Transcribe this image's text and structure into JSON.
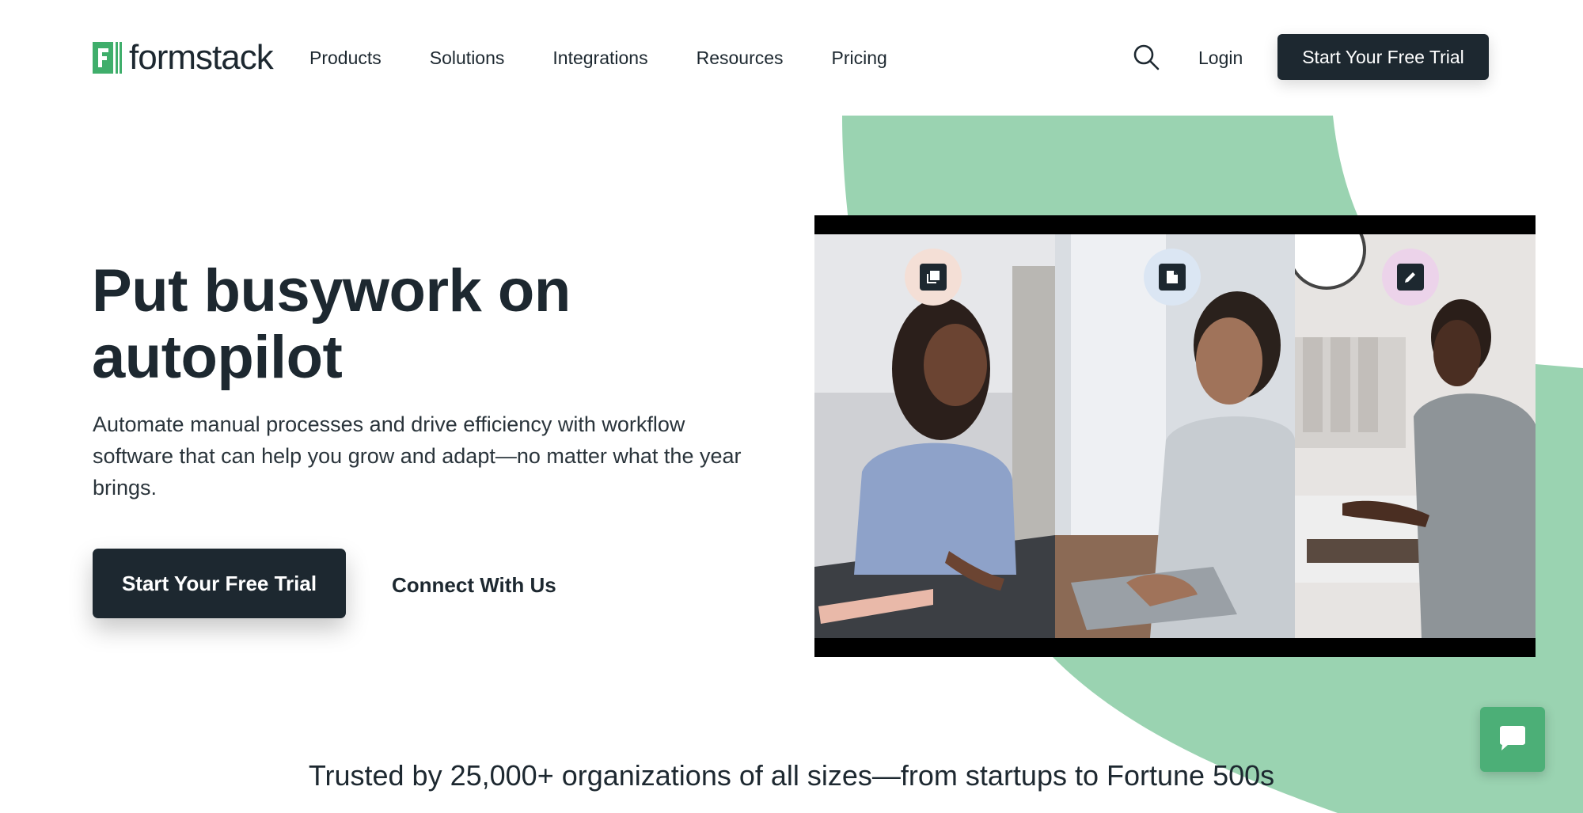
{
  "brand": {
    "name": "formstack",
    "accent": "#9ad3b1",
    "dark": "#1d2830",
    "logo_green": "#3fae6b"
  },
  "nav": {
    "items": [
      {
        "label": "Products"
      },
      {
        "label": "Solutions"
      },
      {
        "label": "Integrations"
      },
      {
        "label": "Resources"
      },
      {
        "label": "Pricing"
      }
    ],
    "search_icon": "search-icon",
    "login_label": "Login",
    "cta_label": "Start Your Free Trial"
  },
  "hero": {
    "title": "Put busywork on autopilot",
    "subtitle": "Automate manual processes and drive efficiency with workflow software that can help you grow and adapt—no matter what the year brings.",
    "primary_cta": "Start Your Free Trial",
    "secondary_cta": "Connect With Us"
  },
  "video": {
    "panels": [
      {
        "icon": "copy-forms-icon",
        "icon_bg": "#f4dfd6"
      },
      {
        "icon": "document-icon",
        "icon_bg": "#dbe6f3"
      },
      {
        "icon": "pen-sign-icon",
        "icon_bg": "#ecd3ea"
      }
    ]
  },
  "trusted_text": "Trusted by 25,000+ organizations of all sizes—from startups to Fortune 500s",
  "chat": {
    "icon": "chat-bubble-icon"
  }
}
